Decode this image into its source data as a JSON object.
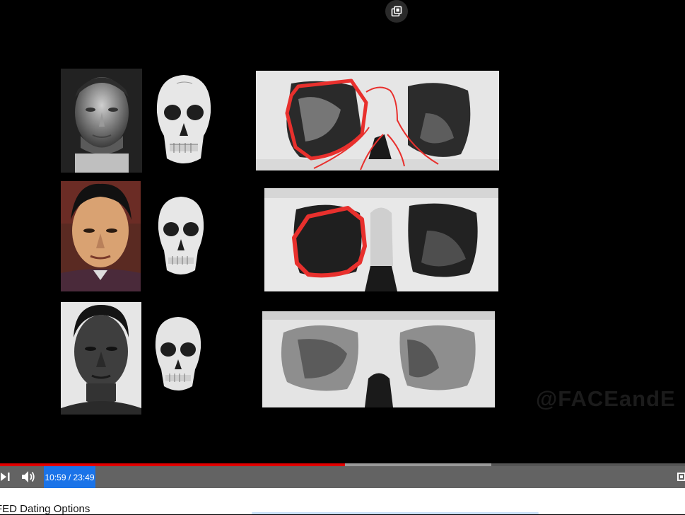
{
  "player": {
    "pip_icon": "picture-in-picture-icon",
    "watermark": "@FACEandE",
    "progress": {
      "played_fraction": 0.504,
      "buffered_fraction": 0.717
    },
    "time_display": "10:59 / 23:49",
    "controls": {
      "next_icon": "skip-next-icon",
      "volume_icon": "volume-icon",
      "right_icon": "settings-icon"
    },
    "accent_color": "#e00000",
    "highlight_color": "#1a73e8"
  },
  "below_video": {
    "title": "FED Dating Options"
  }
}
